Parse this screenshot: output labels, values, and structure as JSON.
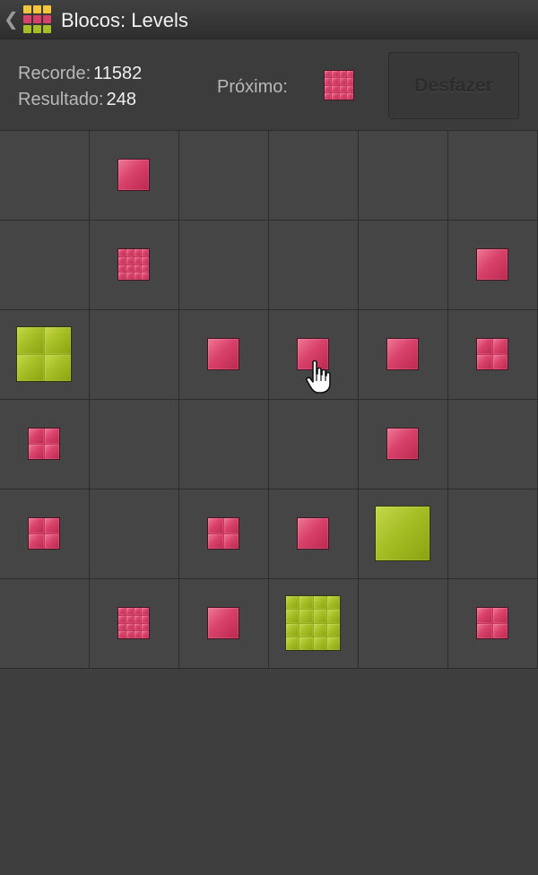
{
  "app_bar": {
    "title": "Blocos: Levels",
    "back_icon": "chevron-left-icon",
    "app_icon": "blocks-grid-icon",
    "app_icon_colors": [
      "#f2c53a",
      "#f2c53a",
      "#f2c53a",
      "#d8416a",
      "#d8416a",
      "#d8416a",
      "#a6bf25",
      "#a6bf25",
      "#a6bf25"
    ]
  },
  "stats": {
    "record_label": "Recorde:",
    "record_value": "11582",
    "result_label": "Resultado:",
    "result_value": "248"
  },
  "next": {
    "label": "Próximo:",
    "piece": {
      "color": "pink",
      "level": 4
    }
  },
  "undo": {
    "label": "Desfazer",
    "enabled": false
  },
  "colors": {
    "pink": "#d8416a",
    "green": "#a6bf25",
    "background": "#3e3e3e"
  },
  "board": {
    "rows": 6,
    "cols": 6,
    "pieces": [
      {
        "row": 0,
        "col": 1,
        "color": "pink",
        "level": 1
      },
      {
        "row": 1,
        "col": 1,
        "color": "pink",
        "level": 4
      },
      {
        "row": 1,
        "col": 5,
        "color": "pink",
        "level": 1
      },
      {
        "row": 2,
        "col": 0,
        "color": "green",
        "level": 2
      },
      {
        "row": 2,
        "col": 2,
        "color": "pink",
        "level": 1
      },
      {
        "row": 2,
        "col": 3,
        "color": "pink",
        "level": 1
      },
      {
        "row": 2,
        "col": 4,
        "color": "pink",
        "level": 1
      },
      {
        "row": 2,
        "col": 5,
        "color": "pink",
        "level": 2
      },
      {
        "row": 3,
        "col": 0,
        "color": "pink",
        "level": 2
      },
      {
        "row": 3,
        "col": 4,
        "color": "pink",
        "level": 1
      },
      {
        "row": 4,
        "col": 0,
        "color": "pink",
        "level": 2
      },
      {
        "row": 4,
        "col": 2,
        "color": "pink",
        "level": 2
      },
      {
        "row": 4,
        "col": 3,
        "color": "pink",
        "level": 1
      },
      {
        "row": 4,
        "col": 4,
        "color": "green",
        "level": 1
      },
      {
        "row": 5,
        "col": 1,
        "color": "pink",
        "level": 4
      },
      {
        "row": 5,
        "col": 2,
        "color": "pink",
        "level": 1
      },
      {
        "row": 5,
        "col": 3,
        "color": "green",
        "level": 4
      },
      {
        "row": 5,
        "col": 5,
        "color": "pink",
        "level": 2
      }
    ]
  },
  "pointer": {
    "icon": "hand-pointer-icon",
    "row": 2,
    "col": 3
  }
}
